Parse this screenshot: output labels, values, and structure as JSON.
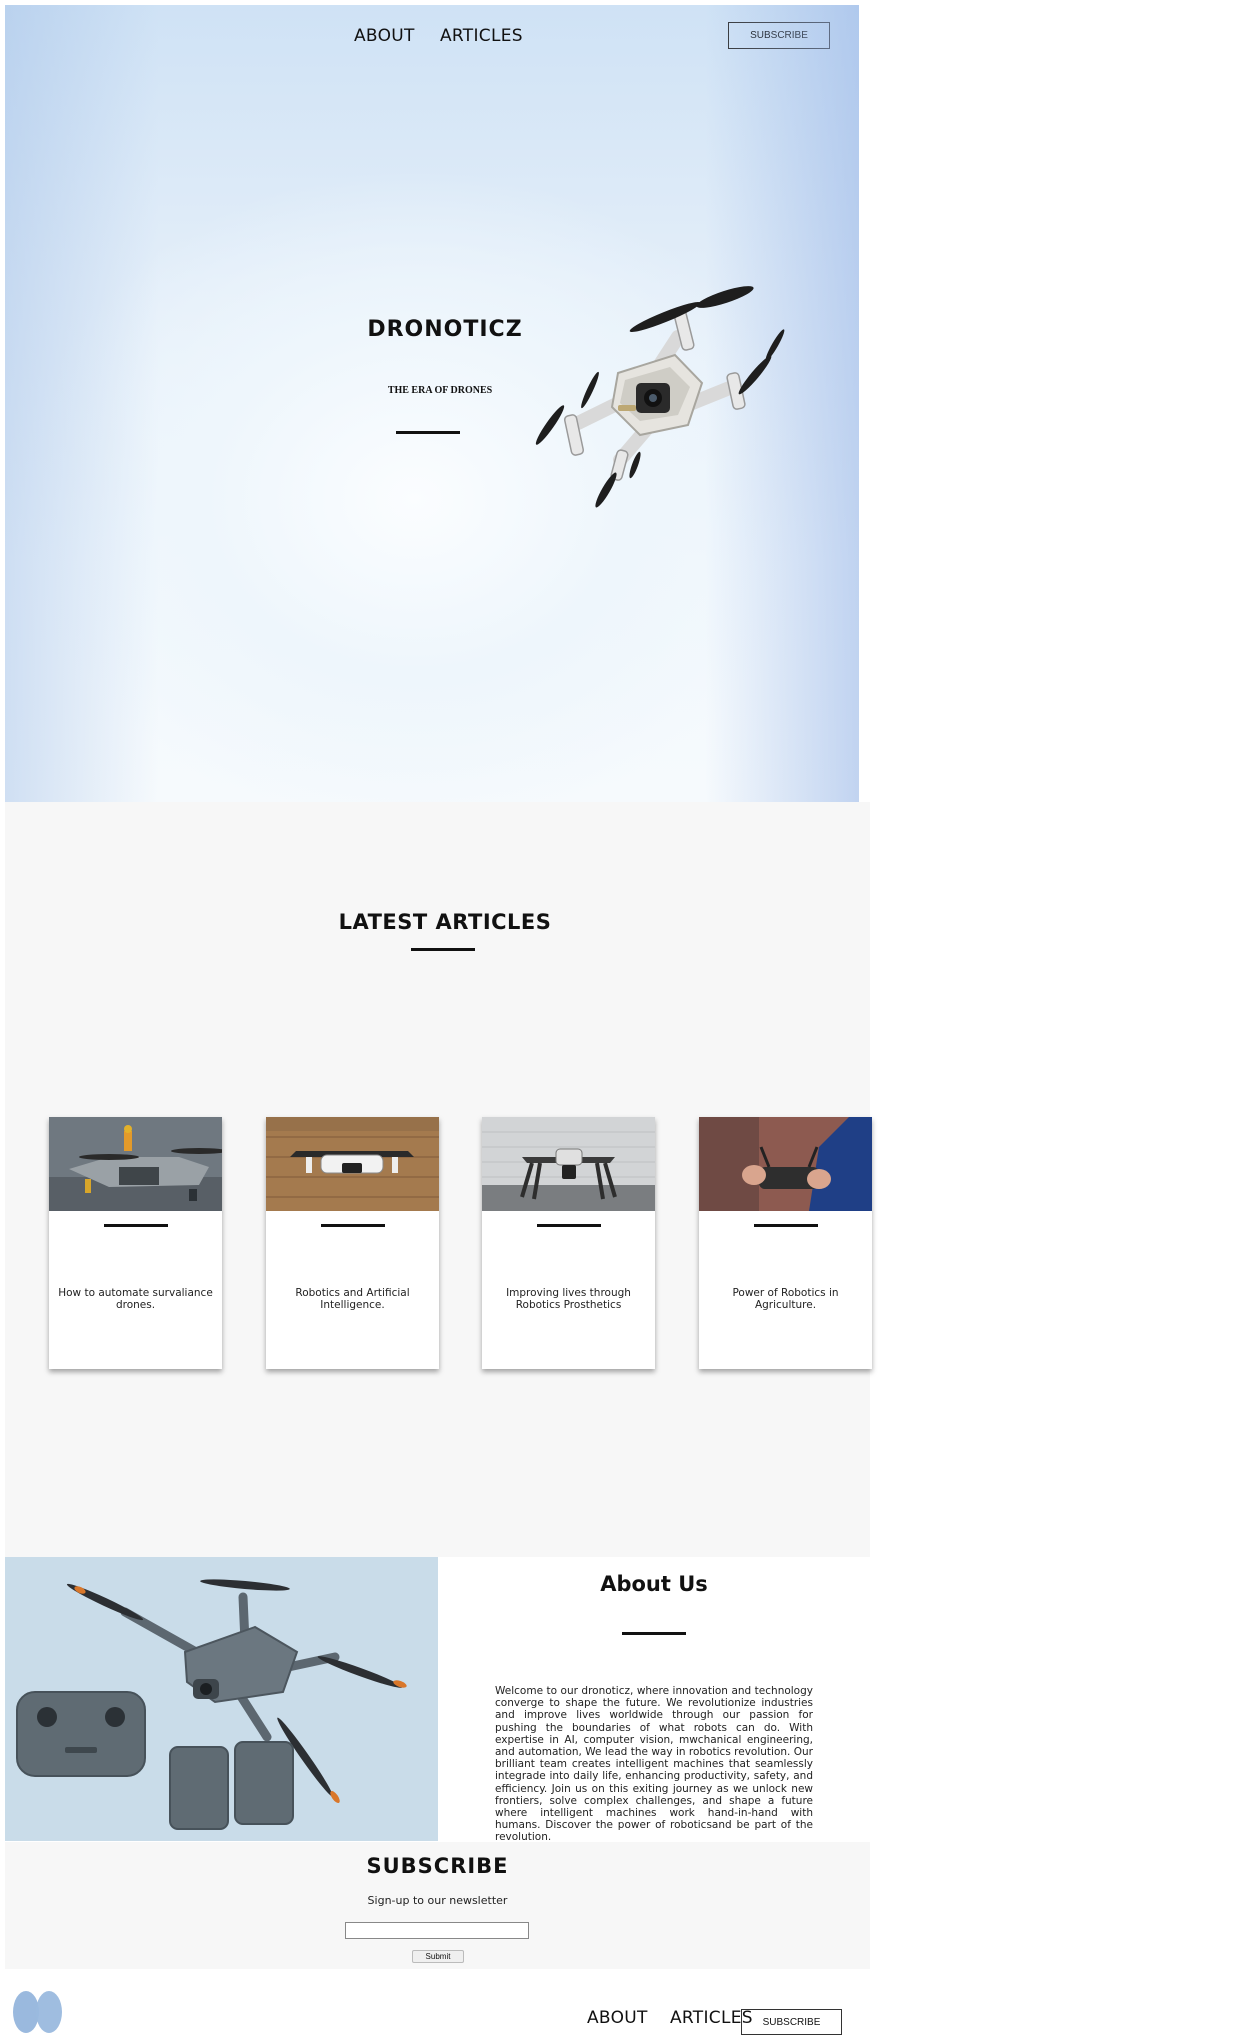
{
  "nav": {
    "about": "ABOUT",
    "articles": "ARTICLES",
    "subscribe": "SUBSCRIBE"
  },
  "hero": {
    "title": "DRONOTICZ",
    "subtitle": "THE ERA OF DRONES",
    "image": "drone-photo"
  },
  "articles": {
    "title": "LATEST ARTICLES",
    "cards": [
      {
        "caption": "How to automate survaliance drones.",
        "image": "drone-with-figurines-photo"
      },
      {
        "caption": "Robotics and Artificial Intelligence.",
        "image": "mini-drone-brick-wall-photo"
      },
      {
        "caption": "Improving lives through Robotics Prosthetics",
        "image": "inspire-drone-photo"
      },
      {
        "caption": "Power of Robotics in Agriculture.",
        "image": "remote-controller-hands-photo"
      }
    ]
  },
  "about": {
    "title": "About Us",
    "text": "Welcome to our dronoticz, where innovation and technology converge to shape the future. We revolutionize industries and improve lives worldwide through our passion for pushing the boundaries of what robots can do. With expertise in AI, computer vision, mwchanical engineering, and automation, We lead the way in robotics revolution. Our brilliant team creates intelligent machines that seamlessly integrade into daily life, enhancing productivity, safety, and efficiency. Join us on this exiting journey as we unlock new frontiers, solve complex challenges, and shape a future where intelligent machines work hand-in-hand with humans. Discover the power of roboticsand be part of the revolution.",
    "image": "drone-and-controller-photo"
  },
  "subscribe": {
    "title": "SUBSCRIBE",
    "description": "Sign-up to our newsletter",
    "input_value": "",
    "submit": "Submit"
  },
  "footer": {
    "about": "ABOUT",
    "articles": "ARTICLES",
    "subscribe": "SUBSCRIBE",
    "logo": "twin-ovals-logo"
  },
  "colors": {
    "hero_sky": "#e3eef9",
    "section_bg": "#f7f7f7",
    "logo_blue": "#9ab9de",
    "text": "#111111"
  }
}
